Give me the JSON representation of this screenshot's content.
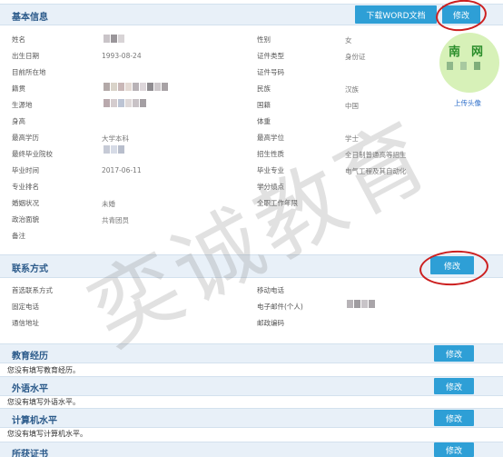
{
  "basic": {
    "title": "基本信息",
    "download_label": "下载WORD文档",
    "edit_label": "修改",
    "left": [
      {
        "label": "姓名",
        "value": ""
      },
      {
        "label": "出生日期",
        "value": "1993-08-24"
      },
      {
        "label": "目前所在地",
        "value": ""
      },
      {
        "label": "籍贯",
        "value": ""
      },
      {
        "label": "生源地",
        "value": ""
      },
      {
        "label": "身高",
        "value": ""
      },
      {
        "label": "最高学历",
        "value": "大学本科"
      },
      {
        "label": "最终毕业院校",
        "value": ""
      },
      {
        "label": "毕业时间",
        "value": "2017-06-11"
      },
      {
        "label": "专业排名",
        "value": ""
      },
      {
        "label": "婚姻状况",
        "value": "未婚"
      },
      {
        "label": "政治面貌",
        "value": "共青团员"
      },
      {
        "label": "备注",
        "value": ""
      }
    ],
    "right": [
      {
        "label": "性别",
        "value": "女"
      },
      {
        "label": "证件类型",
        "value": "身份证"
      },
      {
        "label": "证件号码",
        "value": ""
      },
      {
        "label": "民族",
        "value": "汉族"
      },
      {
        "label": "国籍",
        "value": "中国"
      },
      {
        "label": "体重",
        "value": ""
      },
      {
        "label": "最高学位",
        "value": "学士"
      },
      {
        "label": "招生性质",
        "value": "全日制普通高等招生"
      },
      {
        "label": "毕业专业",
        "value": "电气工程及其自动化"
      },
      {
        "label": "学分绩点",
        "value": ""
      },
      {
        "label": "全职工作年限",
        "value": ""
      }
    ],
    "avatar_text": "南网",
    "upload_label": "上传头像"
  },
  "contact": {
    "title": "联系方式",
    "edit_label": "修改",
    "left": [
      {
        "label": "首选联系方式",
        "value": ""
      },
      {
        "label": "固定电话",
        "value": ""
      },
      {
        "label": "通信地址",
        "value": ""
      }
    ],
    "right": [
      {
        "label": "移动电话",
        "value": ""
      },
      {
        "label": "电子邮件(个人)",
        "value": ""
      },
      {
        "label": "邮政编码",
        "value": ""
      }
    ]
  },
  "sections": [
    {
      "title": "教育经历",
      "edit_label": "修改",
      "note": "您没有填写教育经历。"
    },
    {
      "title": "外语水平",
      "edit_label": "修改",
      "note": "您没有填写外语水平。"
    },
    {
      "title": "计算机水平",
      "edit_label": "修改",
      "note": "您没有填写计算机水平。"
    },
    {
      "title": "所获证书",
      "edit_label": "修改",
      "note": ""
    }
  ],
  "watermark": "奕诚教育",
  "colors": {
    "accent": "#2e9fd6",
    "section_bg": "#e8f0f8",
    "title_text": "#2b5a8a",
    "annotation_circle": "#cc1f1f",
    "avatar_bg": "#d7f1b8"
  }
}
